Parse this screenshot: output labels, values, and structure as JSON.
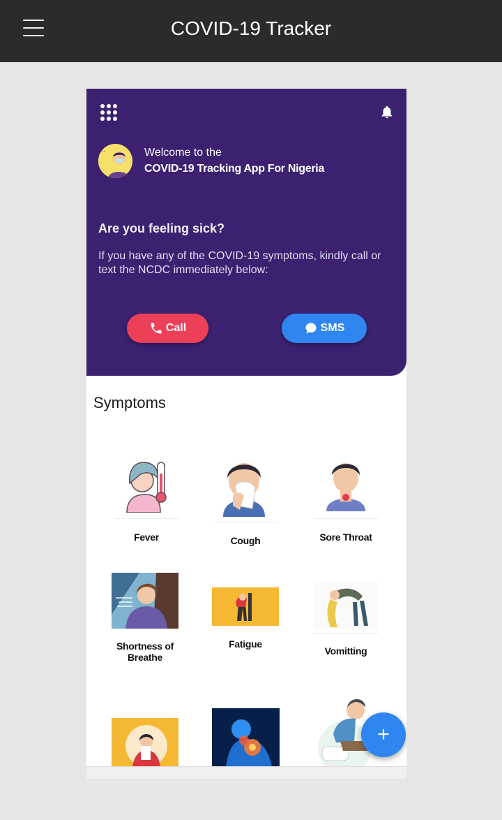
{
  "topbar": {
    "title": "COVID-19 Tracker",
    "menu_icon": "hamburger-icon"
  },
  "header": {
    "apps_icon": "grid-icon",
    "bell_icon": "bell-icon",
    "welcome_line1": "Welcome to the",
    "welcome_line2": "COVID-19 Tracking App For Nigeria",
    "question": "Are you feeling sick?",
    "description": "If you have any of the COVID-19 symptoms, kindly call or text the NCDC immediately below:",
    "call_label": "Call",
    "sms_label": "SMS",
    "colors": {
      "background": "#3b2170",
      "call": "#ee3f58",
      "sms": "#2f86f0"
    }
  },
  "symptoms": {
    "title": "Symptoms",
    "items": [
      {
        "label": "Fever",
        "icon": "fever-thermometer-icon"
      },
      {
        "label": "Cough",
        "icon": "cough-icon"
      },
      {
        "label": "Sore Throat",
        "icon": "sore-throat-icon"
      },
      {
        "label": "Shortness of Breathe",
        "icon": "shortness-of-breath-icon"
      },
      {
        "label": "Fatigue",
        "icon": "fatigue-icon"
      },
      {
        "label": "Vomitting",
        "icon": "vomiting-icon"
      },
      {
        "label": "",
        "icon": "sneezing-icon"
      },
      {
        "label": "",
        "icon": "body-pain-icon"
      },
      {
        "label": "",
        "icon": "diarrhea-icon"
      }
    ]
  },
  "fab": {
    "label": "+",
    "icon": "plus-icon"
  }
}
